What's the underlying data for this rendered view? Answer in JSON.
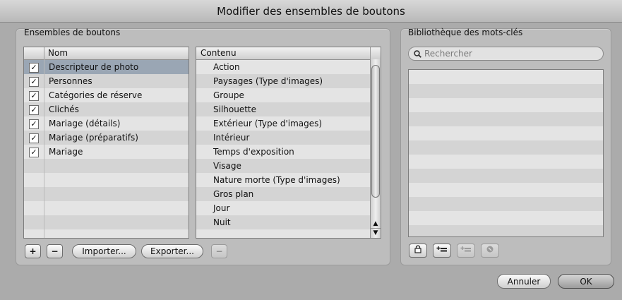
{
  "window": {
    "title": "Modifier des ensembles de boutons"
  },
  "button_sets": {
    "label": "Ensembles de boutons",
    "table": {
      "col_name": "Nom",
      "rows": [
        {
          "name": "Descripteur de photo",
          "checked": true,
          "selected": true
        },
        {
          "name": "Personnes",
          "checked": true
        },
        {
          "name": "Catégories de réserve",
          "checked": true
        },
        {
          "name": "Clichés",
          "checked": true
        },
        {
          "name": "Mariage (détails)",
          "checked": true
        },
        {
          "name": "Mariage (préparatifs)",
          "checked": true
        },
        {
          "name": "Mariage",
          "checked": true
        }
      ]
    },
    "content": {
      "col_title": "Contenu",
      "items": [
        "Action",
        "Paysages (Type d'images)",
        "Groupe",
        "Silhouette",
        "Extérieur (Type d'images)",
        "Intérieur",
        "Temps d'exposition",
        "Visage",
        "Nature morte (Type d'images)",
        "Gros plan",
        "Jour",
        "Nuit"
      ]
    },
    "buttons": {
      "add": "+",
      "remove": "−",
      "import": "Importer...",
      "export": "Exporter...",
      "remove_content": "−"
    }
  },
  "keyword_library": {
    "label": "Bibliothèque des mots-clés",
    "search_placeholder": "Rechercher"
  },
  "dialog_buttons": {
    "cancel": "Annuler",
    "ok": "OK"
  },
  "colors": {
    "selection": "#9aa6b4",
    "background": "#ababab",
    "panel": "#bdbdbd"
  },
  "checkmark": "☑"
}
